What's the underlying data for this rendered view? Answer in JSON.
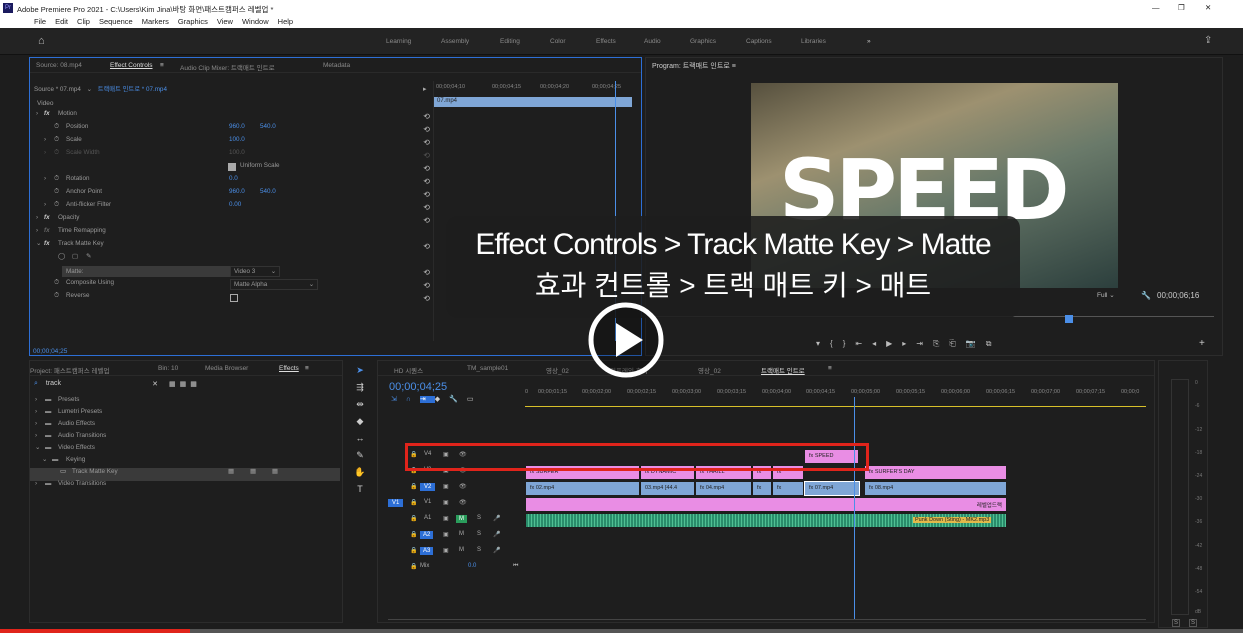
{
  "window": {
    "title": "Adobe Premiere Pro 2021 - C:\\Users\\Kim Jina\\바탕 화면\\패스트캠퍼스 레벨업 *",
    "app_icon": "Pr",
    "controls": [
      "—",
      "❐",
      "✕"
    ]
  },
  "menu": [
    "File",
    "Edit",
    "Clip",
    "Sequence",
    "Markers",
    "Graphics",
    "View",
    "Window",
    "Help"
  ],
  "workspaces": [
    "Learning",
    "Assembly",
    "Editing",
    "Color",
    "Effects",
    "Audio",
    "Graphics",
    "Captions",
    "Libraries"
  ],
  "effect_controls": {
    "tabs": [
      "Source: 08.mp4",
      "Effect Controls",
      "Audio Clip Mixer: 트랙매트 인트로",
      "Metadata"
    ],
    "source": "Source * 07.mp4",
    "sequence": "트랙매트 인트로 * 07.mp4",
    "ruler": [
      "00;00;04;10",
      "00;00;04;15",
      "00;00;04;20",
      "00;00;04;25"
    ],
    "clip_label": "07.mp4",
    "video": "Video",
    "rows": [
      {
        "label": "Motion",
        "fx": true,
        "v1": "",
        "v2": ""
      },
      {
        "label": "Position",
        "v1": "960.0",
        "v2": "540.0"
      },
      {
        "label": "Scale",
        "v1": "100.0",
        "v2": ""
      },
      {
        "label": "Scale Width",
        "v1": "100.0",
        "v2": ""
      },
      {
        "label": "",
        "v1": "Uniform Scale",
        "v2": ""
      },
      {
        "label": "Rotation",
        "v1": "0.0",
        "v2": ""
      },
      {
        "label": "Anchor Point",
        "v1": "960.0",
        "v2": "540.0"
      },
      {
        "label": "Anti-flicker Filter",
        "v1": "0.00",
        "v2": ""
      },
      {
        "label": "Opacity",
        "fx": true,
        "v1": "",
        "v2": ""
      },
      {
        "label": "Time Remapping",
        "fx": true,
        "v1": "",
        "v2": ""
      },
      {
        "label": "Track Matte Key",
        "fx": true,
        "v1": "",
        "v2": ""
      },
      {
        "label": "",
        "v1": "",
        "v2": ""
      },
      {
        "label": "Matte:",
        "v1": "Video 3",
        "v2": ""
      },
      {
        "label": "Composite Using",
        "v1": "Matte Alpha",
        "v2": ""
      },
      {
        "label": "Reverse",
        "v1": "",
        "v2": ""
      }
    ],
    "timecode": "00;00;04;25"
  },
  "program": {
    "title": "Program: 트랙매트 인트로",
    "speed_text": "SPEED",
    "fit": "Full",
    "timecode": "00;00;06;16"
  },
  "project": {
    "tabs": [
      "Project: 패스트캠퍼스 레벨업",
      "Bin: 10",
      "Media Browser",
      "Effects"
    ],
    "search": "track",
    "tree": [
      {
        "label": "Presets",
        "indent": 0
      },
      {
        "label": "Lumetri Presets",
        "indent": 0
      },
      {
        "label": "Audio Effects",
        "indent": 0
      },
      {
        "label": "Audio Transitions",
        "indent": 0
      },
      {
        "label": "Video Effects",
        "indent": 0
      },
      {
        "label": "Keying",
        "indent": 1
      },
      {
        "label": "Track Matte Key",
        "indent": 2
      },
      {
        "label": "Video Transitions",
        "indent": 0
      }
    ]
  },
  "timeline": {
    "tabs": [
      "HD 시퀀스",
      "TM_sample01",
      "영상_02",
      "키프레임 효과",
      "영상_02",
      "트랙매트 인트로"
    ],
    "timecode": "00;00;04;25",
    "ruler": [
      "0",
      "00;00;01;15",
      "00;00;02;00",
      "00;00;02;15",
      "00;00;03;00",
      "00;00;03;15",
      "00;00;04;00",
      "00;00;04;15",
      "00;00;05;00",
      "00;00;05;15",
      "00;00;06;00",
      "00;00;06;15",
      "00;00;07;00",
      "00;00;07;15",
      "00;00;0"
    ],
    "tracks": [
      "V4",
      "V3",
      "V2",
      "V1",
      "A1",
      "A2",
      "A3",
      "Mix"
    ],
    "mix_value": "0.0",
    "clips": {
      "speed": "SPEED",
      "surfer": "SURFER",
      "dynamic": "DYNAMIC",
      "thrill": "THRILL",
      "surfers_day": "SURFER'S DAY",
      "c02": "02.mp4",
      "c03": "03.mp4 [44.4",
      "c04": "04.mp4",
      "c07": "07.mp4",
      "c08": "08.mp4",
      "level_up": "레벨업드랙",
      "audio": "Punk Down (Sting) - MK2.mp3",
      "fx": "fx"
    }
  },
  "meter": {
    "labels": [
      "0",
      "-6",
      "-12",
      "-18",
      "-24",
      "-30",
      "-36",
      "-42",
      "-48",
      "-54",
      "dB"
    ],
    "solo": [
      "S",
      "S"
    ]
  },
  "overlay": {
    "line1": "Effect Controls > Track Matte Key > Matte",
    "line2": "효과 컨트롤 > 트랙 매트 키 > 매트"
  },
  "colors": {
    "accent": "#2d6fd6",
    "highlight": "#e0241b",
    "clip_pink": "#e98de4",
    "clip_blue": "#7fa6d6",
    "audio_green": "#2a8c6b"
  }
}
